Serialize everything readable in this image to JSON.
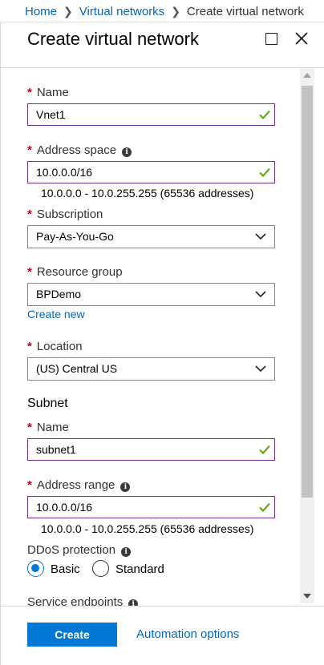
{
  "breadcrumb": {
    "items": [
      "Home",
      "Virtual networks"
    ],
    "current": "Create virtual network"
  },
  "blade": {
    "title": "Create virtual network"
  },
  "form": {
    "name_label": "Name",
    "name_value": "Vnet1",
    "address_space_label": "Address space",
    "address_space_value": "10.0.0.0/16",
    "address_space_helper": "10.0.0.0 - 10.0.255.255 (65536 addresses)",
    "subscription_label": "Subscription",
    "subscription_value": "Pay-As-You-Go",
    "resource_group_label": "Resource group",
    "resource_group_value": "BPDemo",
    "create_new_link": "Create new",
    "location_label": "Location",
    "location_value": "(US) Central US",
    "subnet_heading": "Subnet",
    "subnet_name_label": "Name",
    "subnet_name_value": "subnet1",
    "address_range_label": "Address range",
    "address_range_value": "10.0.0.0/16",
    "address_range_helper": "10.0.0.0 - 10.0.255.255 (65536 addresses)",
    "ddos_label": "DDoS protection",
    "ddos_options": [
      "Basic",
      "Standard"
    ],
    "ddos_selected": "Basic",
    "service_endpoints_label": "Service endpoints"
  },
  "footer": {
    "create_label": "Create",
    "automation_label": "Automation options"
  },
  "colors": {
    "accent": "#0078d4",
    "link": "#0066c0",
    "valid_border": "#7b2f8f",
    "check": "#57a300",
    "required": "#c0001b"
  }
}
